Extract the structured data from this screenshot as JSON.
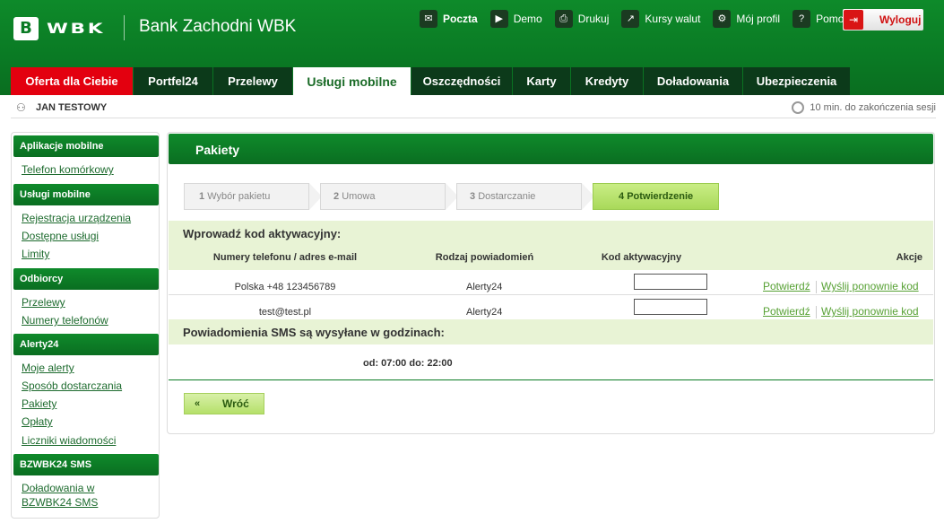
{
  "header": {
    "logo_mark": "B",
    "logo_text": "WBK",
    "bank_name": "Bank Zachodni WBK",
    "top_links": [
      {
        "label": "Poczta",
        "icon": "mail-icon"
      },
      {
        "label": "Demo",
        "icon": "play-icon"
      },
      {
        "label": "Drukuj",
        "icon": "printer-icon"
      },
      {
        "label": "Kursy walut",
        "icon": "chart-icon"
      },
      {
        "label": "Mój profil",
        "icon": "gears-icon"
      },
      {
        "label": "Pomoc",
        "icon": "help-icon"
      }
    ],
    "logout_label": "Wyloguj",
    "brand_color": "#0a7a24",
    "accent_red": "#e3000f"
  },
  "nav": {
    "tabs": [
      {
        "label": "Oferta dla Ciebie"
      },
      {
        "label": "Portfel24"
      },
      {
        "label": "Przelewy"
      },
      {
        "label": "Usługi mobilne"
      },
      {
        "label": "Oszczędności"
      },
      {
        "label": "Karty"
      },
      {
        "label": "Kredyty"
      },
      {
        "label": "Doładowania"
      },
      {
        "label": "Ubezpieczenia"
      }
    ],
    "active": "Usługi mobilne"
  },
  "userbar": {
    "user_name": "JAN TESTOWY",
    "session_text": "10 min. do zakończenia sesji"
  },
  "sidebar": {
    "sections": [
      {
        "title": "Aplikacje mobilne",
        "links": [
          "Telefon komórkowy"
        ]
      },
      {
        "title": "Usługi mobilne",
        "links": [
          "Rejestracja urządzenia",
          "Dostępne usługi",
          "Limity"
        ]
      },
      {
        "title": "Odbiorcy",
        "links": [
          "Przelewy",
          "Numery telefonów"
        ]
      },
      {
        "title": "Alerty24",
        "links": [
          "Moje alerty",
          "Sposób dostarczania",
          "Pakiety",
          "Opłaty",
          "Liczniki wiadomości"
        ]
      },
      {
        "title": "BZWBK24 SMS",
        "links": [
          "Doładowania w",
          "BZWBK24 SMS"
        ]
      }
    ]
  },
  "main": {
    "title": "Pakiety",
    "steps": [
      {
        "num": "1",
        "label": "Wybór pakietu"
      },
      {
        "num": "2",
        "label": "Umowa"
      },
      {
        "num": "3",
        "label": "Dostarczanie"
      },
      {
        "num": "4",
        "label": "Potwierdzenie"
      }
    ],
    "activation_header": "Wprowadź kod aktywacyjny:",
    "columns": [
      "Numery telefonu / adres e-mail",
      "Rodzaj powiadomień",
      "Kod aktywacyjny",
      "Akcje"
    ],
    "rows": [
      {
        "contact": "Polska +48 123456789",
        "type": "Alerty24",
        "code": "",
        "confirm": "Potwierdź",
        "resend": "Wyślij ponownie kod"
      },
      {
        "contact": "test@test.pl",
        "type": "Alerty24",
        "code": "",
        "confirm": "Potwierdź",
        "resend": "Wyślij ponownie kod"
      }
    ],
    "sms_header": "Powiadomienia SMS są wysyłane w godzinach:",
    "hours": "od: 07:00 do: 22:00",
    "back_icon": "«",
    "back_label": "Wróć"
  }
}
